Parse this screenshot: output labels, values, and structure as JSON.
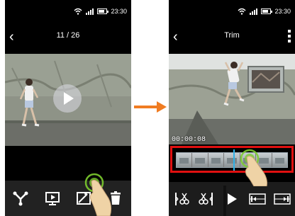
{
  "status_bar": {
    "time": "23:30"
  },
  "left_screen": {
    "counter": "11 / 26",
    "toolbar": [
      {
        "name": "share-icon"
      },
      {
        "name": "slideshow-icon"
      },
      {
        "name": "edit-video-icon"
      },
      {
        "name": "delete-icon"
      }
    ]
  },
  "right_screen": {
    "title": "Trim",
    "timecode": "00:00:08",
    "trim_toolbar": [
      {
        "name": "trim-start-icon"
      },
      {
        "name": "trim-end-icon"
      },
      {
        "name": "play-icon"
      },
      {
        "name": "preview-start-icon"
      },
      {
        "name": "preview-end-icon"
      }
    ]
  },
  "colors": {
    "highlight": "#e01010",
    "playhead": "#2fb2e8",
    "arrow": "#f07c22",
    "touch": "#7ccc2e"
  }
}
